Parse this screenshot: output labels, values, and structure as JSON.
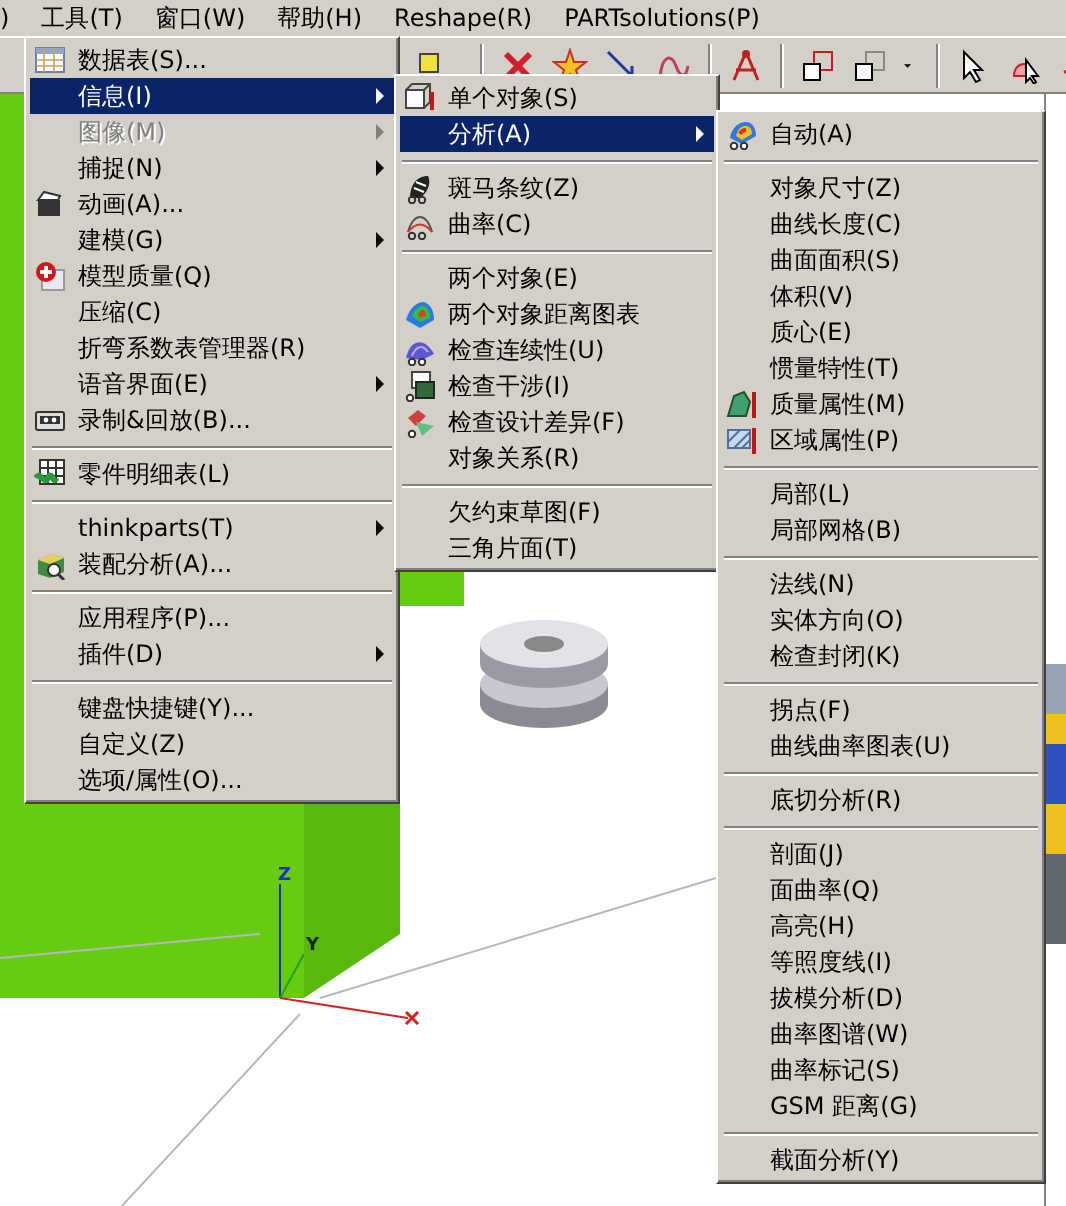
{
  "menu_bar": [
    {
      "label": ")"
    },
    {
      "label": "工具(T)"
    },
    {
      "label": "窗口(W)"
    },
    {
      "label": "帮助(H)"
    },
    {
      "label": "Reshape(R)"
    },
    {
      "label": "PARTsolutions(P)"
    }
  ],
  "viewport": {
    "axis_labels": [
      "Z",
      "Y"
    ]
  },
  "tools_menu": {
    "items": [
      {
        "kind": "item",
        "label": "数据表(S)...",
        "selected": false,
        "disabled": false,
        "submenu": false
      },
      {
        "kind": "item",
        "label": "信息(I)",
        "selected": true,
        "disabled": false,
        "submenu": true
      },
      {
        "kind": "item",
        "label": "图像(M)",
        "selected": false,
        "disabled": true,
        "submenu": true
      },
      {
        "kind": "item",
        "label": "捕捉(N)",
        "selected": false,
        "disabled": false,
        "submenu": true
      },
      {
        "kind": "item",
        "label": "动画(A)...",
        "selected": false,
        "disabled": false,
        "submenu": false
      },
      {
        "kind": "item",
        "label": "建模(G)",
        "selected": false,
        "disabled": false,
        "submenu": true
      },
      {
        "kind": "item",
        "label": "模型质量(Q)",
        "selected": false,
        "disabled": false,
        "submenu": false
      },
      {
        "kind": "item",
        "label": "压缩(C)",
        "selected": false,
        "disabled": false,
        "submenu": false
      },
      {
        "kind": "item",
        "label": "折弯系数表管理器(R)",
        "selected": false,
        "disabled": false,
        "submenu": false
      },
      {
        "kind": "item",
        "label": "语音界面(E)",
        "selected": false,
        "disabled": false,
        "submenu": true
      },
      {
        "kind": "item",
        "label": "录制&回放(B)...",
        "selected": false,
        "disabled": false,
        "submenu": false
      },
      {
        "kind": "separator"
      },
      {
        "kind": "item",
        "label": "零件明细表(L)",
        "selected": false,
        "disabled": false,
        "submenu": false
      },
      {
        "kind": "separator"
      },
      {
        "kind": "item",
        "label": "thinkparts(T)",
        "selected": false,
        "disabled": false,
        "submenu": true
      },
      {
        "kind": "item",
        "label": "装配分析(A)...",
        "selected": false,
        "disabled": false,
        "submenu": false
      },
      {
        "kind": "separator"
      },
      {
        "kind": "item",
        "label": "应用程序(P)...",
        "selected": false,
        "disabled": false,
        "submenu": false
      },
      {
        "kind": "item",
        "label": "插件(D)",
        "selected": false,
        "disabled": false,
        "submenu": true
      },
      {
        "kind": "separator"
      },
      {
        "kind": "item",
        "label": "键盘快捷键(Y)...",
        "selected": false,
        "disabled": false,
        "submenu": false
      },
      {
        "kind": "item",
        "label": "自定义(Z)",
        "selected": false,
        "disabled": false,
        "submenu": false
      },
      {
        "kind": "item",
        "label": "选项/属性(O)...",
        "selected": false,
        "disabled": false,
        "submenu": false
      }
    ]
  },
  "info_menu": {
    "items": [
      {
        "kind": "item",
        "label": "单个对象(S)",
        "selected": false,
        "disabled": false,
        "submenu": false
      },
      {
        "kind": "item",
        "label": "分析(A)",
        "selected": true,
        "disabled": false,
        "submenu": true
      },
      {
        "kind": "separator"
      },
      {
        "kind": "item",
        "label": "斑马条纹(Z)",
        "selected": false,
        "disabled": false,
        "submenu": false
      },
      {
        "kind": "item",
        "label": "曲率(C)",
        "selected": false,
        "disabled": false,
        "submenu": false
      },
      {
        "kind": "separator"
      },
      {
        "kind": "item",
        "label": "两个对象(E)",
        "selected": false,
        "disabled": false,
        "submenu": false
      },
      {
        "kind": "item",
        "label": "两个对象距离图表",
        "selected": false,
        "disabled": false,
        "submenu": false
      },
      {
        "kind": "item",
        "label": "检查连续性(U)",
        "selected": false,
        "disabled": false,
        "submenu": false
      },
      {
        "kind": "item",
        "label": "检查干涉(I)",
        "selected": false,
        "disabled": false,
        "submenu": false
      },
      {
        "kind": "item",
        "label": "检查设计差异(F)",
        "selected": false,
        "disabled": false,
        "submenu": false
      },
      {
        "kind": "item",
        "label": "对象关系(R)",
        "selected": false,
        "disabled": false,
        "submenu": false
      },
      {
        "kind": "separator"
      },
      {
        "kind": "item",
        "label": "欠约束草图(F)",
        "selected": false,
        "disabled": false,
        "submenu": false
      },
      {
        "kind": "item",
        "label": "三角片面(T)",
        "selected": false,
        "disabled": false,
        "submenu": false
      }
    ]
  },
  "analysis_menu": {
    "items": [
      {
        "kind": "item",
        "label": "自动(A)",
        "selected": false,
        "disabled": false,
        "submenu": false
      },
      {
        "kind": "separator"
      },
      {
        "kind": "item",
        "label": "对象尺寸(Z)",
        "selected": false,
        "disabled": false,
        "submenu": false
      },
      {
        "kind": "item",
        "label": "曲线长度(C)",
        "selected": false,
        "disabled": false,
        "submenu": false
      },
      {
        "kind": "item",
        "label": "曲面面积(S)",
        "selected": false,
        "disabled": false,
        "submenu": false
      },
      {
        "kind": "item",
        "label": "体积(V)",
        "selected": false,
        "disabled": false,
        "submenu": false
      },
      {
        "kind": "item",
        "label": "质心(E)",
        "selected": false,
        "disabled": false,
        "submenu": false
      },
      {
        "kind": "item",
        "label": "惯量特性(T)",
        "selected": false,
        "disabled": false,
        "submenu": false
      },
      {
        "kind": "item",
        "label": "质量属性(M)",
        "selected": false,
        "disabled": false,
        "submenu": false
      },
      {
        "kind": "item",
        "label": "区域属性(P)",
        "selected": false,
        "disabled": false,
        "submenu": false
      },
      {
        "kind": "separator"
      },
      {
        "kind": "item",
        "label": "局部(L)",
        "selected": false,
        "disabled": false,
        "submenu": false
      },
      {
        "kind": "item",
        "label": "局部网格(B)",
        "selected": false,
        "disabled": false,
        "submenu": false
      },
      {
        "kind": "separator"
      },
      {
        "kind": "item",
        "label": "法线(N)",
        "selected": false,
        "disabled": false,
        "submenu": false
      },
      {
        "kind": "item",
        "label": "实体方向(O)",
        "selected": false,
        "disabled": false,
        "submenu": false
      },
      {
        "kind": "item",
        "label": "检查封闭(K)",
        "selected": false,
        "disabled": false,
        "submenu": false
      },
      {
        "kind": "separator"
      },
      {
        "kind": "item",
        "label": "拐点(F)",
        "selected": false,
        "disabled": false,
        "submenu": false
      },
      {
        "kind": "item",
        "label": "曲线曲率图表(U)",
        "selected": false,
        "disabled": false,
        "submenu": false
      },
      {
        "kind": "separator"
      },
      {
        "kind": "item",
        "label": "底切分析(R)",
        "selected": false,
        "disabled": false,
        "submenu": false
      },
      {
        "kind": "separator"
      },
      {
        "kind": "item",
        "label": "剖面(J)",
        "selected": false,
        "disabled": false,
        "submenu": false
      },
      {
        "kind": "item",
        "label": "面曲率(Q)",
        "selected": false,
        "disabled": false,
        "submenu": false
      },
      {
        "kind": "item",
        "label": "高亮(H)",
        "selected": false,
        "disabled": false,
        "submenu": false
      },
      {
        "kind": "item",
        "label": "等照度线(I)",
        "selected": false,
        "disabled": false,
        "submenu": false
      },
      {
        "kind": "item",
        "label": "拔模分析(D)",
        "selected": false,
        "disabled": false,
        "submenu": false
      },
      {
        "kind": "item",
        "label": "曲率图谱(W)",
        "selected": false,
        "disabled": false,
        "submenu": false
      },
      {
        "kind": "item",
        "label": "曲率标记(S)",
        "selected": false,
        "disabled": false,
        "submenu": false
      },
      {
        "kind": "item",
        "label": "GSM 距离(G)",
        "selected": false,
        "disabled": false,
        "submenu": false
      },
      {
        "kind": "separator"
      },
      {
        "kind": "item",
        "label": "截面分析(Y)",
        "selected": false,
        "disabled": false,
        "submenu": false
      }
    ]
  }
}
